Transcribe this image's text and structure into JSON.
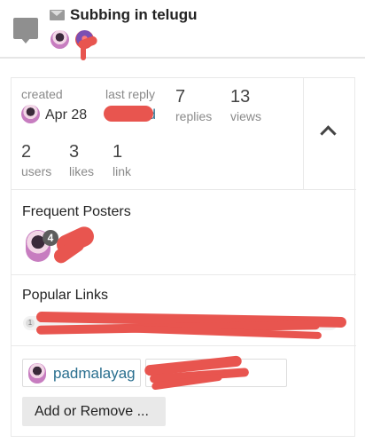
{
  "topic": {
    "title": "Subbing in telugu"
  },
  "stats": {
    "created_label": "created",
    "created_date": "Apr 28",
    "last_reply_label": "last reply",
    "last_reply_date_partial": "d",
    "replies_count": "7",
    "replies_label": "replies",
    "views_count": "13",
    "views_label": "views",
    "users_count": "2",
    "users_label": "users",
    "likes_count": "3",
    "likes_label": "likes",
    "links_count": "1",
    "links_label": "link"
  },
  "frequent_posters": {
    "title": "Frequent Posters",
    "post_count_badge": "4"
  },
  "popular_links": {
    "title": "Popular Links",
    "link_click_count": "1"
  },
  "participants": {
    "username": "padmalayag",
    "add_remove_label": "Add or Remove ..."
  },
  "icons": {
    "message": "message-bubble-icon",
    "private": "envelope-icon",
    "collapse": "chevron-up-icon"
  },
  "colors": {
    "link": "#2a6f8f",
    "redaction": "#e8554f",
    "muted_text": "#8a8a8a"
  }
}
